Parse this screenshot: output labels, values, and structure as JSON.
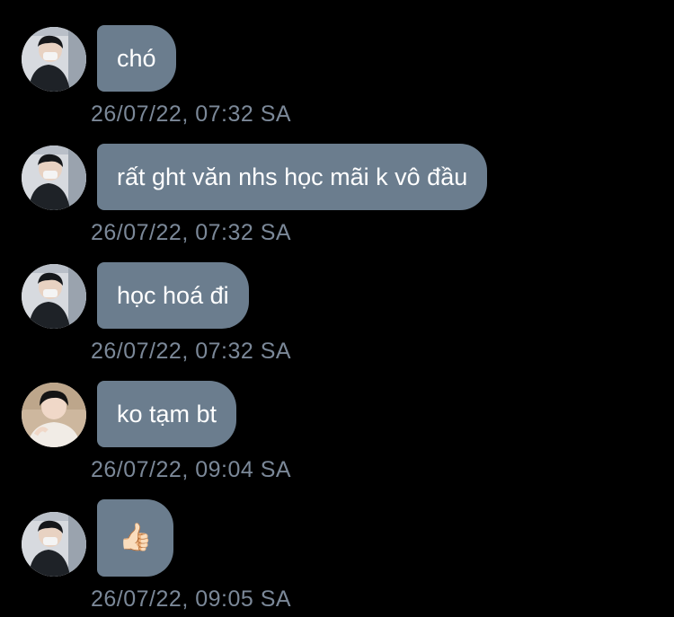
{
  "messages": [
    {
      "text": "chó",
      "timestamp": "26/07/22, 07:32 SA",
      "avatar": "avatar-boy-masked"
    },
    {
      "text": "rất ght văn nhs học mãi k vô đầu",
      "timestamp": "26/07/22, 07:32 SA",
      "avatar": "avatar-boy-masked"
    },
    {
      "text": "học hoá đi",
      "timestamp": "26/07/22, 07:32 SA",
      "avatar": "avatar-boy-masked"
    },
    {
      "text": "ko tạm bt",
      "timestamp": "26/07/22, 09:04 SA",
      "avatar": "avatar-boy-light"
    },
    {
      "text": "👍🏻",
      "timestamp": "26/07/22, 09:05 SA",
      "avatar": "avatar-boy-masked"
    }
  ],
  "colors": {
    "background": "#000000",
    "bubble": "#6b7d8e",
    "bubble_text": "#ffffff",
    "timestamp": "#7b8898"
  }
}
